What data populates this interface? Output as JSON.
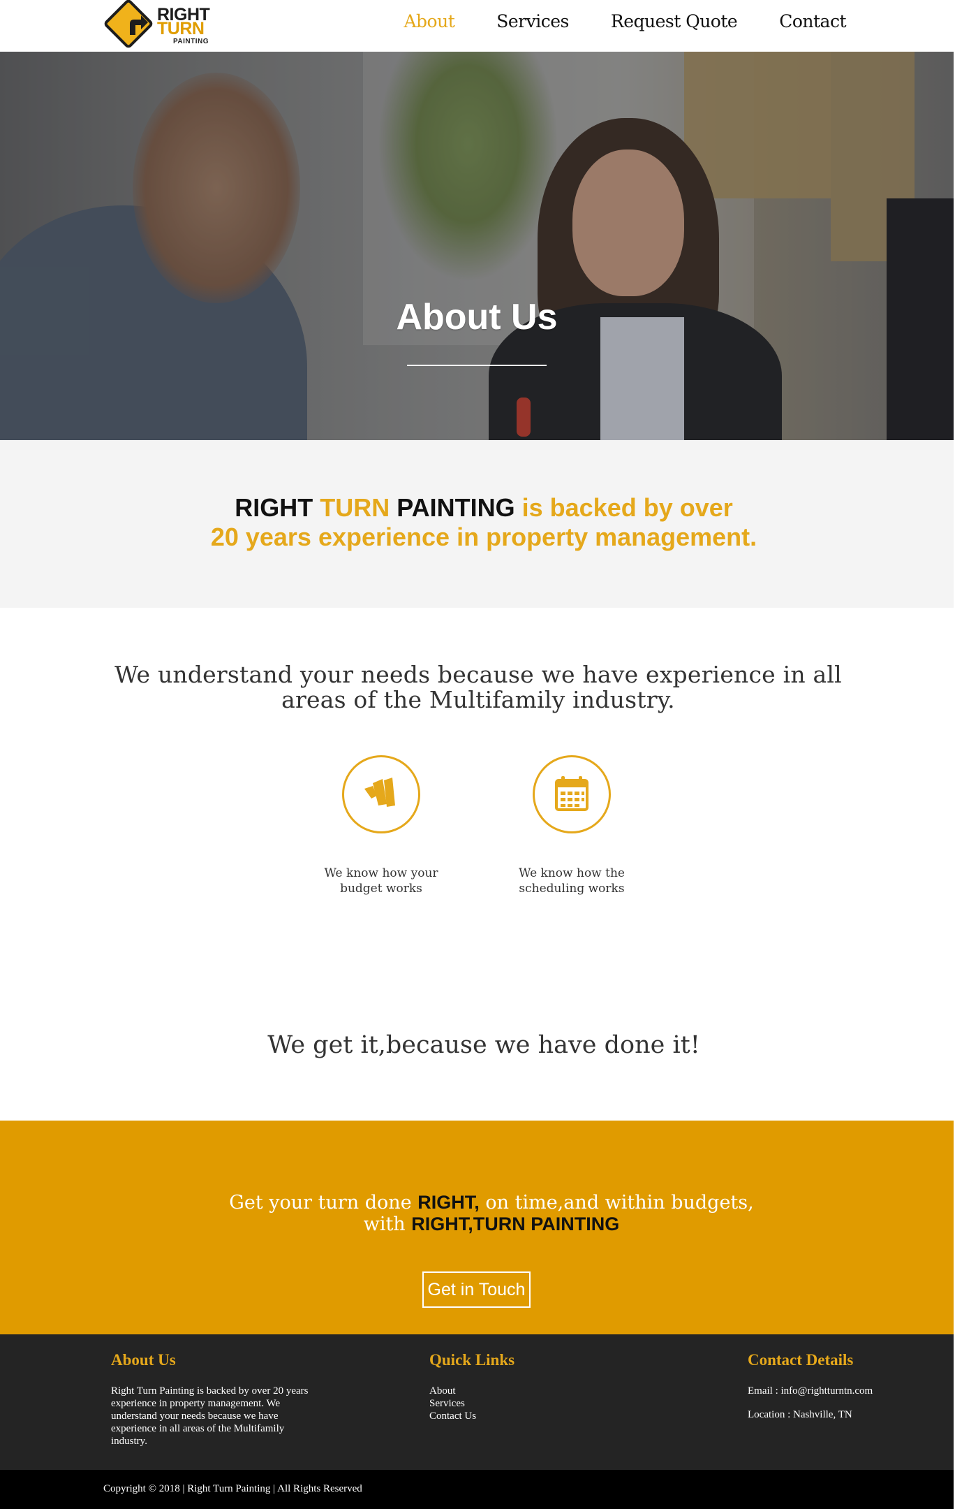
{
  "brand": {
    "logo_line1": "RIGHT",
    "logo_line2": "TURN",
    "logo_line3": "PAINTING",
    "accent_color": "#e5a81b",
    "cta_color": "#e09b00"
  },
  "nav": {
    "items": [
      {
        "label": "About",
        "active": true
      },
      {
        "label": "Services",
        "active": false
      },
      {
        "label": "Request Quote",
        "active": false
      },
      {
        "label": "Contact",
        "active": false
      }
    ]
  },
  "hero": {
    "title": "About Us"
  },
  "backed": {
    "part1": "RIGHT",
    "part2": "TURN",
    "part3": "PAINTING",
    "part4": "is backed by over",
    "line2": "20 years experience in property management."
  },
  "understand": {
    "text": "We understand your needs because we have experience in all areas of the Multifamily industry."
  },
  "features": [
    {
      "icon": "budget-icon",
      "line1": "We know how your",
      "line2": "budget works"
    },
    {
      "icon": "calendar-icon",
      "line1": "We know how the",
      "line2": "scheduling works"
    }
  ],
  "done": {
    "text": "We get it,because we have done it!"
  },
  "cta": {
    "part1": "Get your turn done",
    "strong1": "RIGHT,",
    "part2": "on time,and within budgets,",
    "part3": "with",
    "strong2": "RIGHT,TURN PAINTING",
    "button_label": "Get in Touch"
  },
  "footer": {
    "about": {
      "heading": "About Us",
      "body": "Right Turn Painting is backed by over 20 years experience in property management. We understand your needs because we have experience in all areas of the Multifamily industry."
    },
    "quick_links": {
      "heading": "Quick Links",
      "links": [
        "About",
        "Services",
        "Contact Us"
      ]
    },
    "contact": {
      "heading": "Contact Details",
      "email": "Email : info@rightturntn.com",
      "location": "Location : Nashville, TN"
    },
    "copyright": "Copyright © 2018 | Right Turn Painting | All Rights Reserved"
  }
}
